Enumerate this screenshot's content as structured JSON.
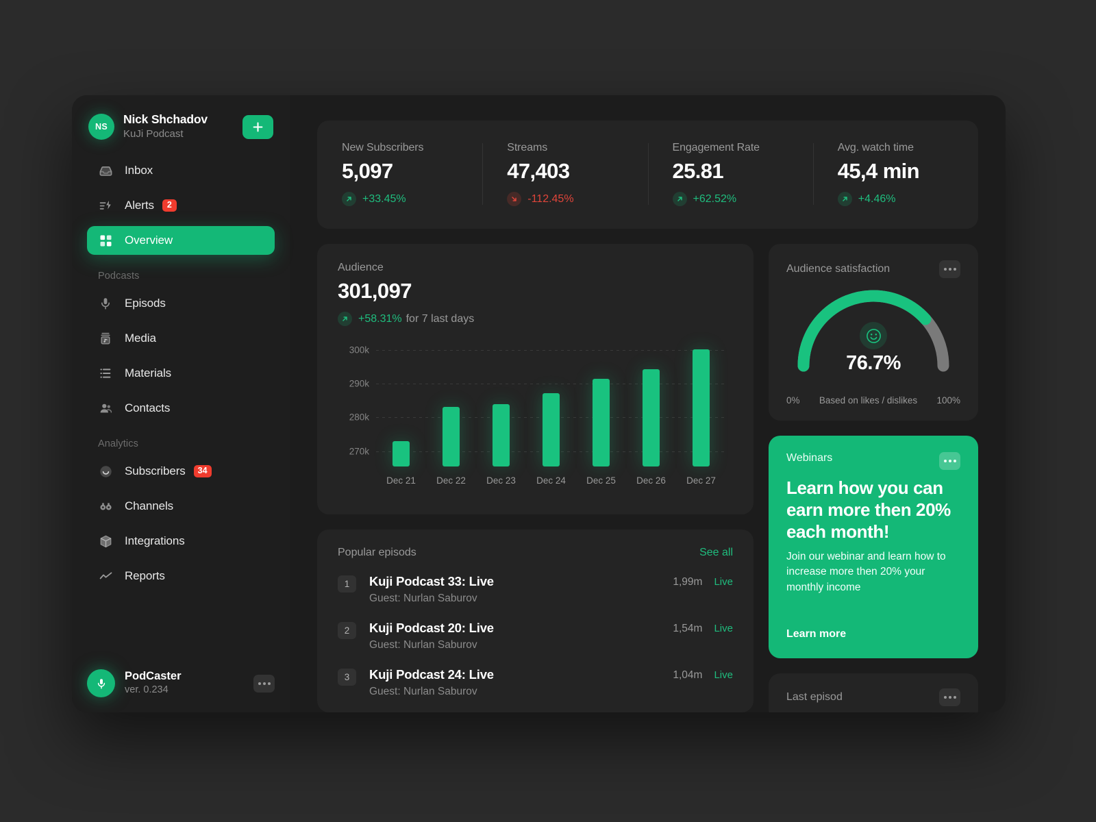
{
  "sidebar": {
    "profile": {
      "initials": "NS",
      "name": "Nick Shchadov",
      "subtitle": "KuJi Podcast",
      "add_icon": "plus-icon"
    },
    "nav_primary": [
      {
        "label": "Inbox",
        "icon": "inbox-icon",
        "badge": null,
        "active": false
      },
      {
        "label": "Alerts",
        "icon": "alerts-icon",
        "badge": "2",
        "active": false
      },
      {
        "label": "Overview",
        "icon": "grid-icon",
        "badge": null,
        "active": true
      }
    ],
    "group_podcasts": "Podcasts",
    "nav_podcasts": [
      {
        "label": "Episods",
        "icon": "microphone-icon",
        "badge": null
      },
      {
        "label": "Media",
        "icon": "media-icon",
        "badge": null
      },
      {
        "label": "Materials",
        "icon": "list-icon",
        "badge": null
      },
      {
        "label": "Contacts",
        "icon": "contacts-icon",
        "badge": null
      }
    ],
    "group_analytics": "Analytics",
    "nav_analytics": [
      {
        "label": "Subscribers",
        "icon": "smiley-icon",
        "badge": "34"
      },
      {
        "label": "Channels",
        "icon": "binoculars-icon",
        "badge": null
      },
      {
        "label": "Integrations",
        "icon": "box-icon",
        "badge": null
      },
      {
        "label": "Reports",
        "icon": "trend-icon",
        "badge": null
      }
    ],
    "footer": {
      "name": "PodCaster",
      "version": "ver. 0.234",
      "icon": "microphone-icon",
      "menu_icon": "more-icon"
    }
  },
  "kpis": [
    {
      "label": "New Subscribers",
      "value": "5,097",
      "delta": "+33.45%",
      "direction": "up"
    },
    {
      "label": "Streams",
      "value": "47,403",
      "delta": "-112.45%",
      "direction": "down"
    },
    {
      "label": "Engagement Rate",
      "value": "25.81",
      "delta": "+62.52%",
      "direction": "up"
    },
    {
      "label": "Avg. watch time",
      "value": "45,4 min",
      "delta": "+4.46%",
      "direction": "up"
    }
  ],
  "audience": {
    "label": "Audience",
    "value": "301,097",
    "delta": "+58.31%",
    "delta_suffix": "for 7 last days"
  },
  "chart_data": {
    "type": "bar",
    "title": "Audience",
    "xlabel": "",
    "ylabel": "",
    "categories": [
      "Dec 21",
      "Dec 22",
      "Dec 23",
      "Dec 24",
      "Dec 25",
      "Dec 26",
      "Dec 27"
    ],
    "values": [
      273000,
      283200,
      284000,
      287200,
      291500,
      294200,
      300200
    ],
    "ytick_labels": [
      "300k",
      "290k",
      "280k",
      "270k"
    ],
    "ytick_values": [
      300000,
      290000,
      280000,
      270000
    ],
    "ylim": [
      265500,
      302000
    ],
    "grid": true,
    "legend": "none",
    "series_color": "#19c27f"
  },
  "episodes": {
    "title": "Popular episods",
    "see_all": "See all",
    "items": [
      {
        "rank": "1",
        "name": "Kuji Podcast 33: Live",
        "guest": "Guest: Nurlan Saburov",
        "plays": "1,99m",
        "status": "Live"
      },
      {
        "rank": "2",
        "name": "Kuji Podcast 20: Live",
        "guest": "Guest: Nurlan Saburov",
        "plays": "1,54m",
        "status": "Live"
      },
      {
        "rank": "3",
        "name": "Kuji Podcast 24: Live",
        "guest": "Guest: Nurlan Saburov",
        "plays": "1,04m",
        "status": "Live"
      }
    ]
  },
  "satisfaction": {
    "title": "Audience satisfaction",
    "value": "76.7%",
    "percent": 76.7,
    "min_label": "0%",
    "max_label": "100%",
    "caption": "Based on likes / dislikes",
    "menu_icon": "more-icon",
    "center_icon": "smiley-icon",
    "arc_color": "#19c27f",
    "track_color": "#7a7a7a"
  },
  "webinar": {
    "kicker": "Webinars",
    "title": "Learn how you can earn more then 20% each month!",
    "body": "Join our webinar and learn how to increase more then 20% your monthly income",
    "cta": "Learn more",
    "menu_icon": "more-icon",
    "bg_color": "#14b877"
  },
  "last_episode": {
    "title": "Last episod",
    "menu_icon": "more-icon"
  },
  "colors": {
    "accent": "#14b877",
    "accent_bright": "#19c27f",
    "danger": "#e0453a",
    "badge": "#f03c2e",
    "card": "#242424",
    "shell": "#1c1c1c",
    "sidebar": "#1e1e1e",
    "backdrop": "#2b2b2b"
  }
}
